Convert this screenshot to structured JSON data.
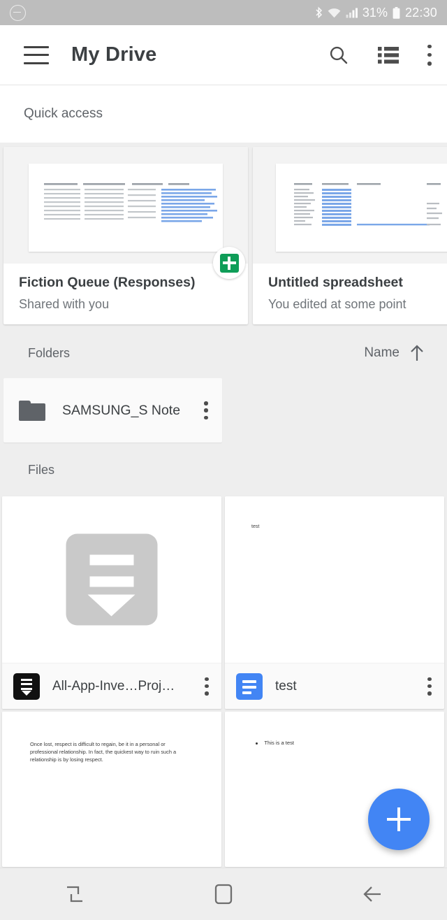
{
  "status_bar": {
    "left_icon": "minus-circle-icon",
    "bluetooth_icon": "bluetooth-icon",
    "wifi_icon": "wifi-icon",
    "signal_icon": "cellular-signal-icon",
    "battery_percent": "31%",
    "battery_icon": "battery-icon",
    "time": "22:30"
  },
  "app_bar": {
    "menu_icon": "hamburger-menu-icon",
    "title": "My Drive",
    "search_icon": "search-icon",
    "view_toggle_icon": "list-view-icon",
    "overflow_icon": "more-vert-icon"
  },
  "quick_access": {
    "header": "Quick access",
    "cards": [
      {
        "title": "Fiction Queue (Responses)",
        "subtitle": "Shared with you",
        "badge_icon": "google-sheets-icon",
        "badge_color": "#0f9d58",
        "thumbnail_type": "spreadsheet"
      },
      {
        "title": "Untitled spreadsheet",
        "subtitle": "You edited at some point",
        "badge_icon": "",
        "badge_color": "",
        "thumbnail_type": "spreadsheet"
      }
    ]
  },
  "folders_section": {
    "header": "Folders",
    "sort_label": "Name",
    "sort_direction_icon": "arrow-up-icon",
    "items": [
      {
        "name": "SAMSUNG_S Note",
        "icon": "folder-icon",
        "overflow_icon": "more-vert-icon"
      }
    ]
  },
  "files_section": {
    "header": "Files",
    "items": [
      {
        "name": "All-App-Inve…Projects.zip",
        "icon": "zip-archive-icon",
        "icon_color": "#111111",
        "thumbnail_type": "zip-placeholder",
        "overflow_icon": "more-vert-icon"
      },
      {
        "name": "test",
        "icon": "google-docs-icon",
        "icon_color": "#4285f4",
        "thumbnail_type": "document-text",
        "thumbnail_text": "test",
        "overflow_icon": "more-vert-icon"
      },
      {
        "name": "",
        "icon": "",
        "icon_color": "",
        "thumbnail_type": "document-paragraph",
        "thumbnail_text": "Once lost, respect is difficult to regain, be it in a personal or professional relationship. In fact, the quickest way to ruin such a relationship is by losing respect.",
        "overflow_icon": ""
      },
      {
        "name": "",
        "icon": "",
        "icon_color": "",
        "thumbnail_type": "document-bullet",
        "thumbnail_text": "This is a test",
        "overflow_icon": ""
      }
    ]
  },
  "fab": {
    "icon": "plus-icon",
    "color": "#4285f4"
  },
  "nav_bar": {
    "recents_icon": "recents-icon",
    "home_icon": "home-icon",
    "back_icon": "back-arrow-icon"
  }
}
